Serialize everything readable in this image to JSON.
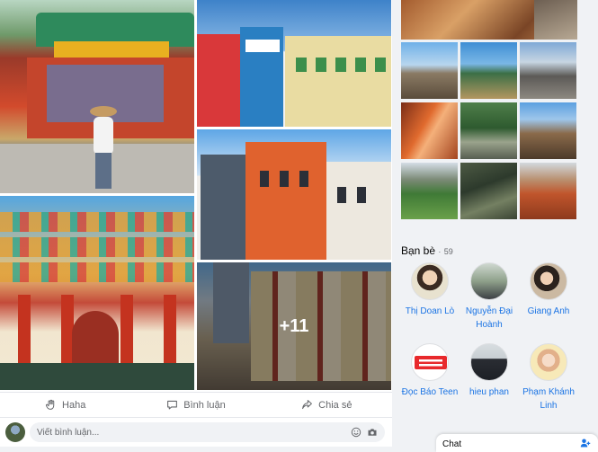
{
  "post": {
    "photos": [
      {
        "name": "photo-opera-stage"
      },
      {
        "name": "photo-shophouses"
      },
      {
        "name": "photo-temple"
      },
      {
        "name": "photo-colonial-street"
      },
      {
        "name": "photo-chinatown-street"
      }
    ],
    "more_count": "+11",
    "actions": {
      "like_label": "Haha",
      "comment_label": "Bình luận",
      "share_label": "Chia sẻ"
    },
    "comment": {
      "placeholder": "Viết bình luận..."
    }
  },
  "sidebar": {
    "friends": {
      "title": "Bạn bè",
      "separator": "·",
      "count": "59",
      "items": [
        {
          "name": "Thị Doan Lò"
        },
        {
          "name": "Nguyễn Đại Hoành"
        },
        {
          "name": "Giang Anh"
        },
        {
          "name": "Đọc Báo Teen"
        },
        {
          "name": "hieu phan"
        },
        {
          "name": "Phạm Khánh Linh"
        }
      ]
    }
  },
  "chat": {
    "label": "Chat"
  },
  "colors": {
    "link": "#1b74e4",
    "secondary_text": "#65676b",
    "divider": "#e4e6eb"
  }
}
